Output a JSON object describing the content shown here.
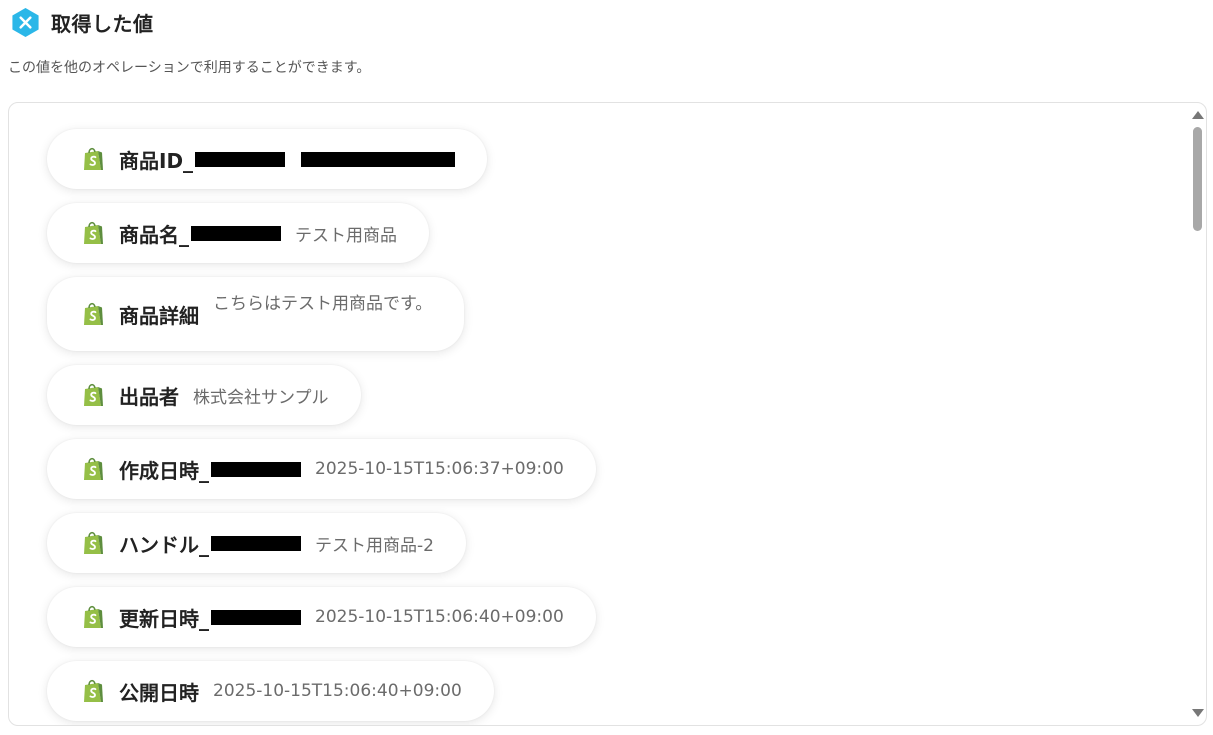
{
  "header": {
    "title": "取得した値",
    "icon": "yoom-x-badge-icon",
    "icon_color": "#2bb7e8"
  },
  "subtitle": "この値を他のオペレーションで利用することができます。",
  "items": [
    {
      "label": "商品ID_",
      "value": "",
      "icon": "shopify-bag-icon"
    },
    {
      "label": "商品名_",
      "value": "テスト用商品",
      "icon": "shopify-bag-icon"
    },
    {
      "label": "商品詳細",
      "value": "こちらはテスト用商品です。",
      "icon": "shopify-bag-icon"
    },
    {
      "label": "出品者",
      "value": "株式会社サンプル",
      "icon": "shopify-bag-icon"
    },
    {
      "label": "作成日時_",
      "value": "2025-10-15T15:06:37+09:00",
      "icon": "shopify-bag-icon"
    },
    {
      "label": "ハンドル_",
      "value": "テスト用商品-2",
      "icon": "shopify-bag-icon"
    },
    {
      "label": "更新日時_",
      "value": "2025-10-15T15:06:40+09:00",
      "icon": "shopify-bag-icon"
    },
    {
      "label": "公開日時",
      "value": "2025-10-15T15:06:40+09:00",
      "icon": "shopify-bag-icon"
    }
  ],
  "colors": {
    "shopify_green": "#95bf47",
    "shopify_dark": "#5e8e3e",
    "label_text": "#222222",
    "value_text": "#6b6b6b"
  }
}
